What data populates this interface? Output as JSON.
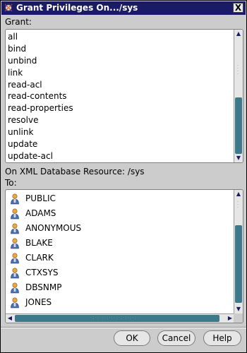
{
  "window": {
    "title": "Grant Privileges On.../sys",
    "close_label": "X"
  },
  "grant": {
    "label": "Grant:",
    "items": [
      "all",
      "bind",
      "unbind",
      "link",
      "read-acl",
      "read-contents",
      "read-properties",
      "resolve",
      "unlink",
      "update",
      "update-acl"
    ]
  },
  "resource_label": "On XML Database Resource: /sys",
  "to": {
    "label": "To:",
    "users": [
      "PUBLIC",
      "ADAMS",
      "ANONYMOUS",
      "BLAKE",
      "CLARK",
      "CTXSYS",
      "DBSNMP",
      "JONES"
    ],
    "user_icon": "person-icon"
  },
  "buttons": {
    "ok": "OK",
    "cancel": "Cancel",
    "help": "Help"
  },
  "colors": {
    "titlebar": "#1a1a66",
    "scroll_thumb": "#3a7a8a",
    "background": "#cccccc"
  }
}
